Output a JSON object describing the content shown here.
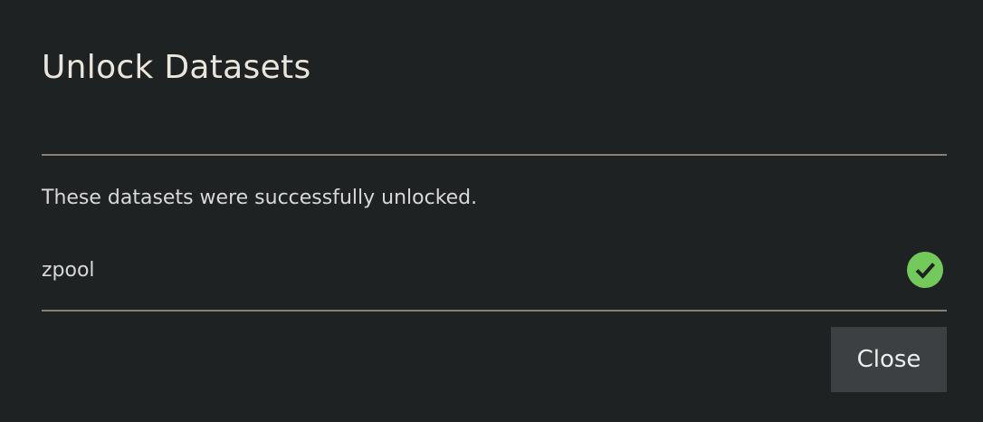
{
  "dialog": {
    "title": "Unlock Datasets",
    "message": "These datasets were successfully unlocked.",
    "datasets": [
      {
        "name": "zpool",
        "status_icon": "check-circle-icon",
        "status_color": "#73c95a"
      }
    ],
    "close_label": "Close"
  },
  "colors": {
    "background": "#1f2223",
    "divider": "#8a7f75",
    "button_background": "#3c4042",
    "success": "#73c95a"
  }
}
